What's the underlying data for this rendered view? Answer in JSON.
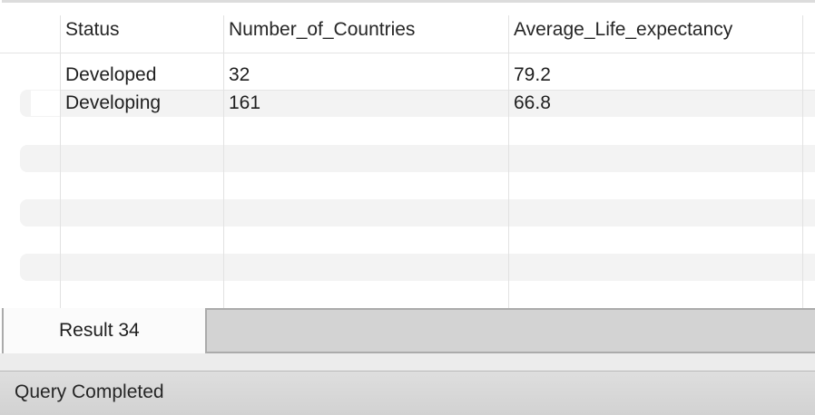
{
  "result_grid": {
    "columns": [
      "Status",
      "Number_of_Countries",
      "Average_Life_expectancy"
    ],
    "rows": [
      [
        "Developed",
        "32",
        "79.2"
      ],
      [
        "Developing",
        "161",
        "66.8"
      ]
    ]
  },
  "result_tabs": [
    {
      "label": "Result 34",
      "active": true
    }
  ],
  "status_bar": {
    "message": "Query Completed"
  }
}
